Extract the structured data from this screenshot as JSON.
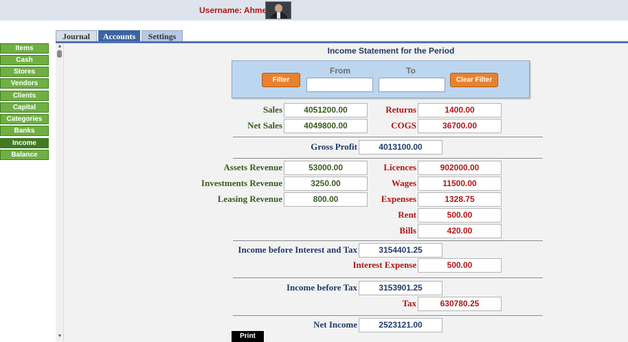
{
  "header": {
    "username_label": "Username: Ahmed"
  },
  "tabs": [
    {
      "label": "Journal"
    },
    {
      "label": "Accounts"
    },
    {
      "label": "Settings"
    }
  ],
  "nav": [
    {
      "label": "Items"
    },
    {
      "label": "Cash"
    },
    {
      "label": "Stores"
    },
    {
      "label": "Vendors"
    },
    {
      "label": "Clients"
    },
    {
      "label": "Capital"
    },
    {
      "label": "Categories"
    },
    {
      "label": "Banks"
    },
    {
      "label": "Income"
    },
    {
      "label": "Balance"
    }
  ],
  "statement": {
    "title": "Income Statement for the Period",
    "filter": {
      "filter_label": "Filter",
      "clear_label": "Clear Filter",
      "from_label": "From",
      "to_label": "To",
      "from_value": "",
      "to_value": ""
    },
    "sales": {
      "label": "Sales",
      "value": "4051200.00"
    },
    "returns": {
      "label": "Returns",
      "value": "1400.00"
    },
    "net_sales": {
      "label": "Net Sales",
      "value": "4049800.00"
    },
    "cogs": {
      "label": "COGS",
      "value": "36700.00"
    },
    "gross_profit": {
      "label": "Gross Profit",
      "value": "4013100.00"
    },
    "assets_revenue": {
      "label": "Assets Revenue",
      "value": "53000.00"
    },
    "investments_revenue": {
      "label": "Investments Revenue",
      "value": "3250.00"
    },
    "leasing_revenue": {
      "label": "Leasing Revenue",
      "value": "800.00"
    },
    "licences": {
      "label": "Licences",
      "value": "902000.00"
    },
    "wages": {
      "label": "Wages",
      "value": "11500.00"
    },
    "expenses": {
      "label": "Expenses",
      "value": "1328.75"
    },
    "rent": {
      "label": "Rent",
      "value": "500.00"
    },
    "bills": {
      "label": "Bills",
      "value": "420.00"
    },
    "ebit": {
      "label": "Income before Interest and Tax",
      "value": "3154401.25"
    },
    "interest_expense": {
      "label": "Interest Expense",
      "value": "500.00"
    },
    "income_before_tax": {
      "label": "Income before Tax",
      "value": "3153901.25"
    },
    "tax": {
      "label": "Tax",
      "value": "630780.25"
    },
    "net_income": {
      "label": "Net Income",
      "value": "2523121.00"
    },
    "print_label": "Print"
  },
  "colors": {
    "nav_green": "#6fb043",
    "nav_active": "#3f7a24",
    "tab_active": "#3c64a4",
    "filter_button": "#e9822e",
    "revenue_text": "#3a5a1e",
    "expense_text": "#b01515",
    "total_text": "#1f3a66"
  }
}
